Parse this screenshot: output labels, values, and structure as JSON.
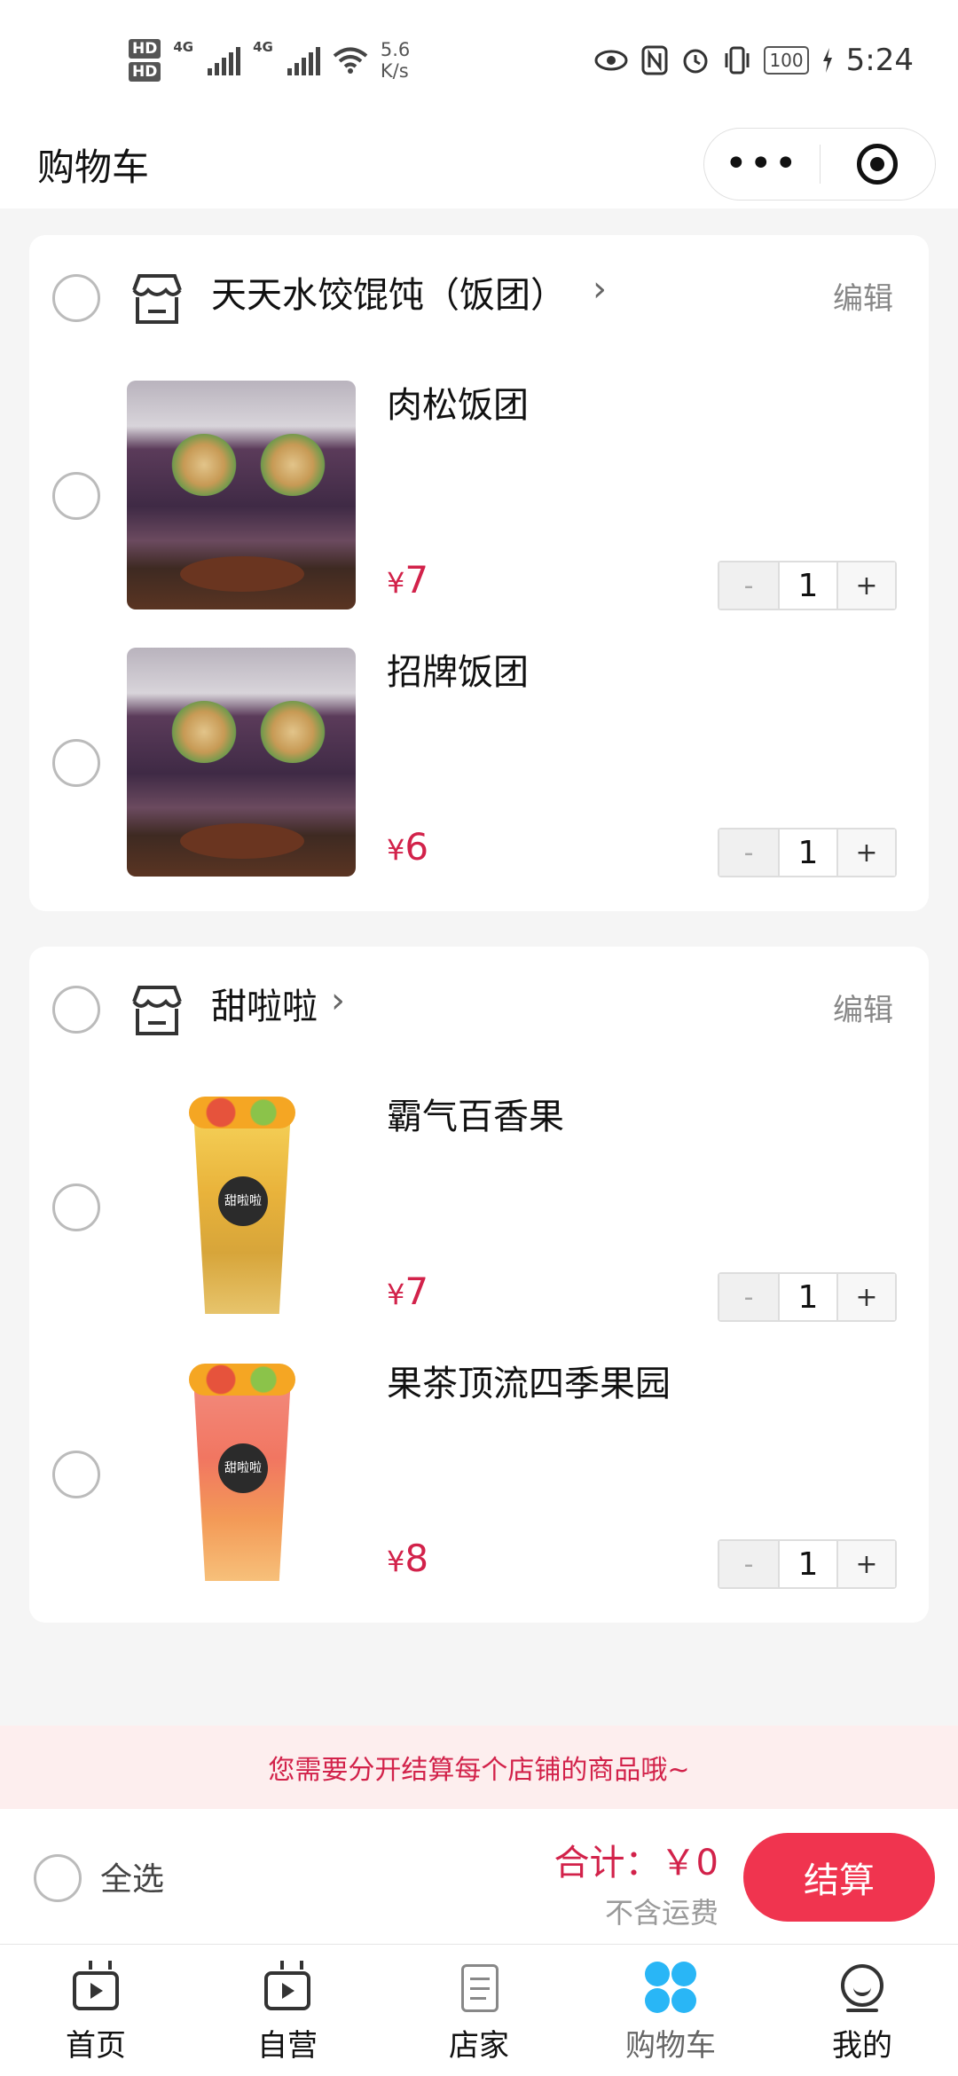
{
  "status_bar": {
    "hd1": "HD",
    "hd2": "HD",
    "net1": "4G",
    "net2": "4G",
    "speed_value": "5.6",
    "speed_unit": "K/s",
    "battery": "100",
    "time": "5:24"
  },
  "header": {
    "title": "购物车",
    "more_glyph": "•••"
  },
  "shops": [
    {
      "name": "天天水饺馄饨（饭团）",
      "arrow": "›",
      "edit_label": "编辑",
      "items": [
        {
          "name": "肉松饭团",
          "currency": "¥",
          "price": "7",
          "qty": "1",
          "image": "rice-ball-photo"
        },
        {
          "name": "招牌饭团",
          "currency": "¥",
          "price": "6",
          "qty": "1",
          "image": "rice-ball-photo"
        }
      ]
    },
    {
      "name": "甜啦啦",
      "arrow": "›",
      "edit_label": "编辑",
      "items": [
        {
          "name": "霸气百香果",
          "currency": "¥",
          "price": "7",
          "qty": "1",
          "image": "passion-fruit-drink-photo",
          "badge": "甜啦啦"
        },
        {
          "name": "果茶顶流四季果园",
          "currency": "¥",
          "price": "8",
          "qty": "1",
          "image": "fruit-tea-drink-photo",
          "badge": "甜啦啦"
        }
      ]
    }
  ],
  "stepper": {
    "minus": "-",
    "plus": "+"
  },
  "notice": "您需要分开结算每个店铺的商品哦~",
  "checkout": {
    "select_all": "全选",
    "total": "合计：￥0",
    "shipping": "不含运费",
    "button": "结算"
  },
  "tabs": [
    {
      "label": "首页",
      "icon": "tv-icon"
    },
    {
      "label": "自营",
      "icon": "tv-icon"
    },
    {
      "label": "店家",
      "icon": "document-icon"
    },
    {
      "label": "购物车",
      "icon": "clover-icon",
      "active": true
    },
    {
      "label": "我的",
      "icon": "profile-icon"
    }
  ],
  "colors": {
    "accent": "#d2224a",
    "checkout_button": "#f0344f",
    "notice_bg": "#fdeeee",
    "active_tab_icon": "#29b6f6"
  }
}
